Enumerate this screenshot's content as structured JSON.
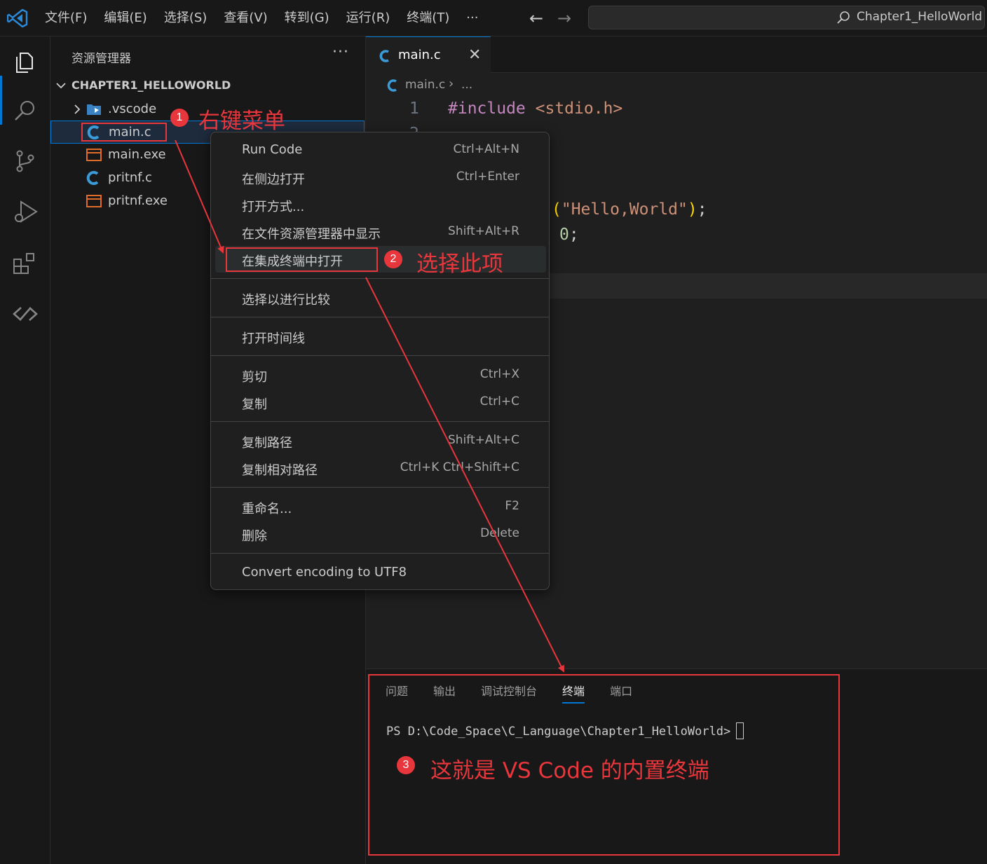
{
  "menu": [
    "文件(F)",
    "编辑(E)",
    "选择(S)",
    "查看(V)",
    "转到(G)",
    "运行(R)",
    "终端(T)",
    "···"
  ],
  "command_center": {
    "text": "Chapter1_HelloWorld"
  },
  "sidebar": {
    "title": "资源管理器",
    "more": "···",
    "folder": "CHAPTER1_HELLOWORLD",
    "items": [
      {
        "label": ".vscode",
        "icon": "vscode-folder-icon"
      },
      {
        "label": "main.c",
        "icon": "c-file-icon"
      },
      {
        "label": "main.exe",
        "icon": "exe-file-icon"
      },
      {
        "label": "pritnf.c",
        "icon": "c-file-icon"
      },
      {
        "label": "pritnf.exe",
        "icon": "exe-file-icon"
      }
    ]
  },
  "editor": {
    "tab": {
      "label": "main.c",
      "close": "✕"
    },
    "breadcrumb": {
      "file": "main.c",
      "sep": "›",
      "more": "..."
    },
    "line_numbers": [
      "1",
      "2"
    ],
    "code": {
      "include_kw": "#include",
      "include_target": "<stdio.h>",
      "printf_open": "(",
      "printf_str": "\"Hello,World\"",
      "printf_close": ")",
      "printf_semi": ";",
      "return_val": "0",
      "return_semi": ";"
    }
  },
  "context_menu": {
    "items": [
      {
        "label": "Run Code",
        "key": "Ctrl+Alt+N"
      },
      {
        "label": "在侧边打开",
        "key": "Ctrl+Enter"
      },
      {
        "label": "打开方式...",
        "key": ""
      },
      {
        "label": "在文件资源管理器中显示",
        "key": "Shift+Alt+R"
      },
      {
        "label": "在集成终端中打开",
        "key": ""
      },
      {
        "label": "选择以进行比较",
        "key": ""
      },
      {
        "label": "打开时间线",
        "key": ""
      },
      {
        "label": "剪切",
        "key": "Ctrl+X"
      },
      {
        "label": "复制",
        "key": "Ctrl+C"
      },
      {
        "label": "复制路径",
        "key": "Shift+Alt+C"
      },
      {
        "label": "复制相对路径",
        "key": "Ctrl+K Ctrl+Shift+C"
      },
      {
        "label": "重命名...",
        "key": "F2"
      },
      {
        "label": "删除",
        "key": "Delete"
      },
      {
        "label": "Convert encoding to UTF8",
        "key": ""
      }
    ]
  },
  "panel": {
    "tabs": [
      "问题",
      "输出",
      "调试控制台",
      "终端",
      "端口"
    ],
    "active_tab": "终端",
    "prompt": "PS D:\\Code_Space\\C_Language\\Chapter1_HelloWorld>"
  },
  "annotations": [
    {
      "badge": "1",
      "text": "右键菜单"
    },
    {
      "badge": "2",
      "text": "选择此项"
    },
    {
      "badge": "3",
      "text": "这就是 VS Code 的内置终端"
    }
  ],
  "colors": {
    "accent": "#0078d4",
    "annotation": "#e8363d",
    "c_icon": "#3b9bd9",
    "exe_icon": "#e06c2c"
  }
}
